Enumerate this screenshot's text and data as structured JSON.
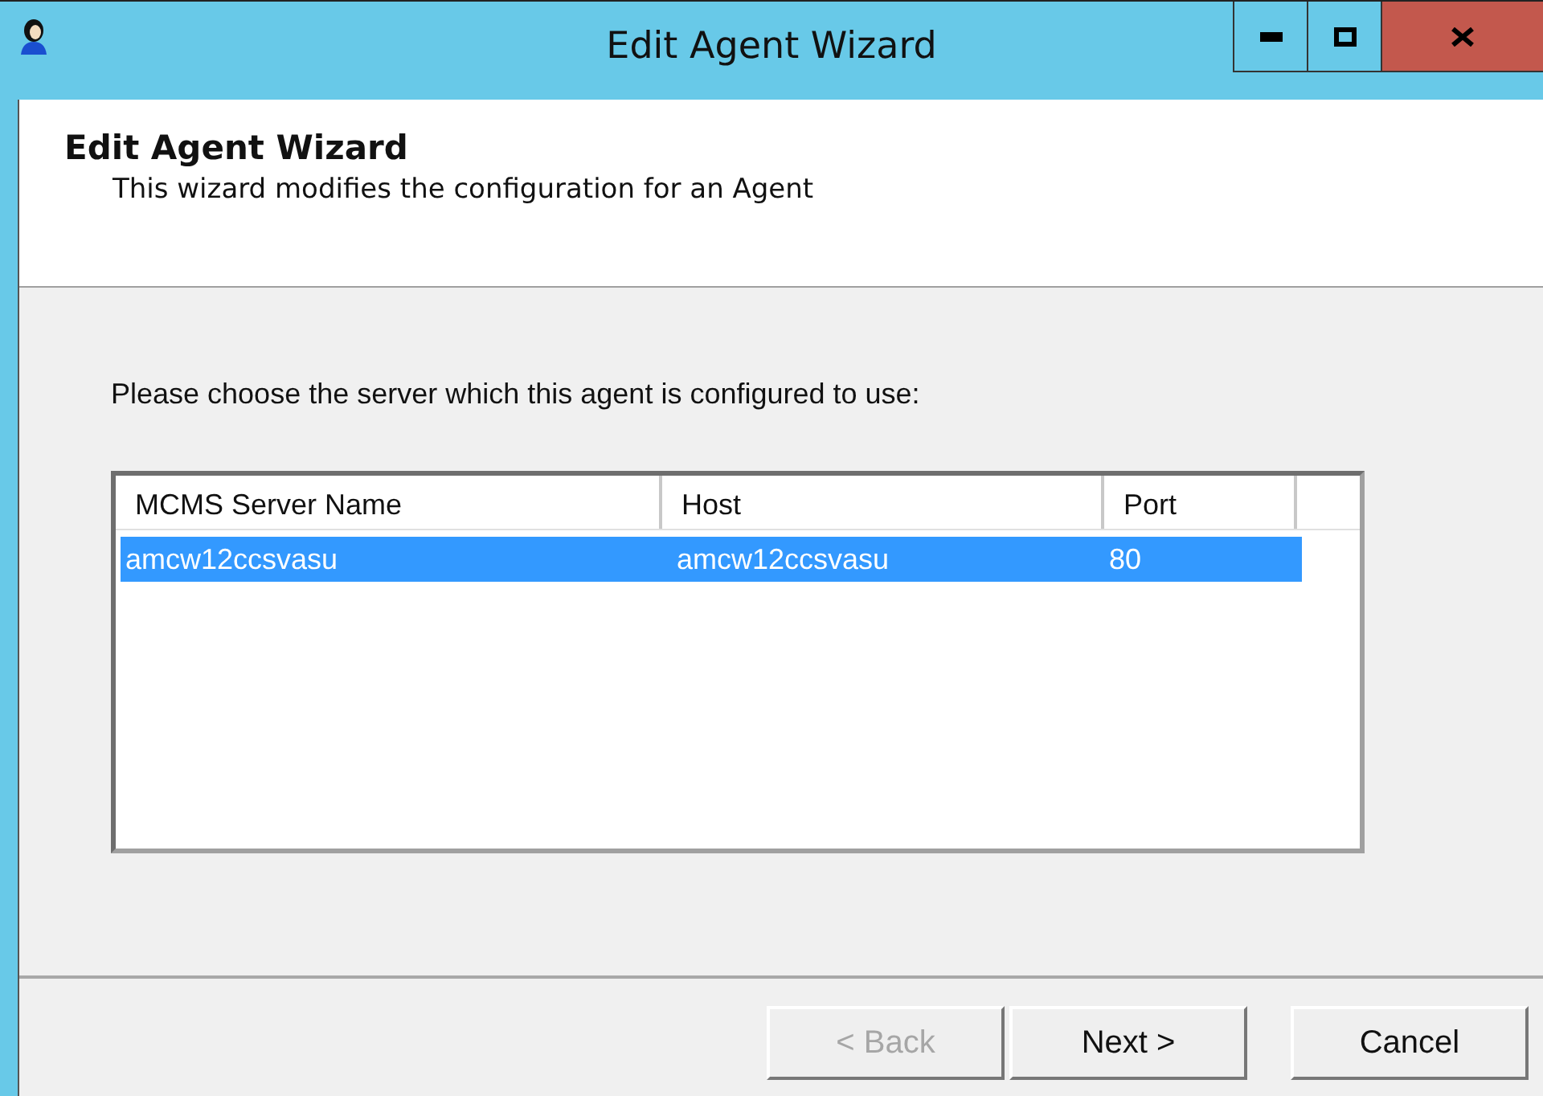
{
  "window": {
    "title": "Edit Agent Wizard"
  },
  "header": {
    "title": "Edit Agent Wizard",
    "subtitle": "This wizard modifies the configuration for an Agent"
  },
  "prompt": "Please choose the server which this agent is configured to use:",
  "table": {
    "columns": [
      "MCMS Server Name",
      "Host",
      "Port"
    ],
    "rows": [
      {
        "cells": [
          "amcw12ccsvasu",
          "amcw12ccsvasu",
          "80"
        ],
        "selected": true
      }
    ]
  },
  "buttons": [
    {
      "label": "< Back",
      "disabled": true
    },
    {
      "label": "Next >",
      "disabled": false
    },
    {
      "label": "Cancel",
      "disabled": false
    }
  ]
}
